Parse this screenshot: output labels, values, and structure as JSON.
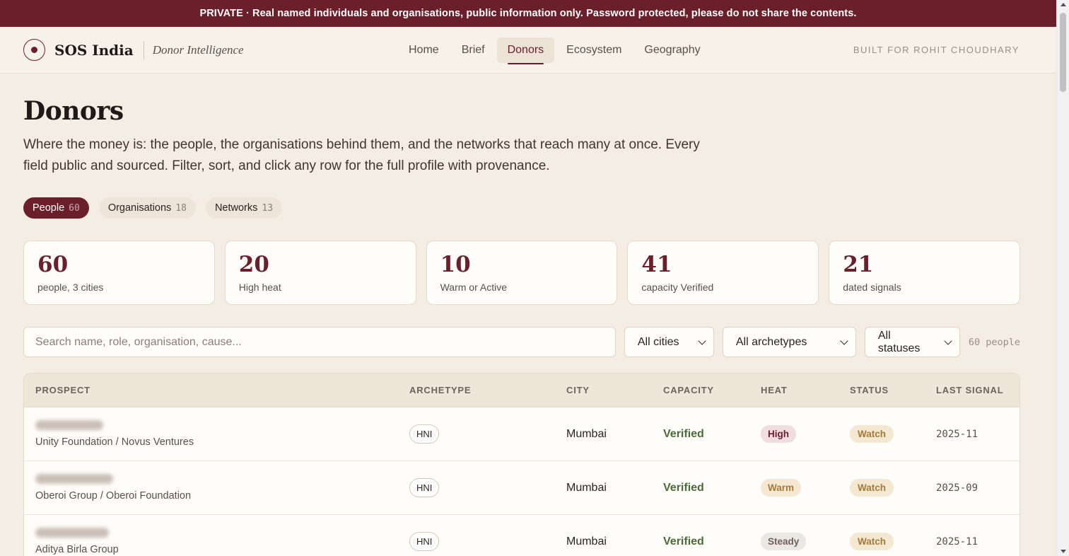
{
  "banner": "PRIVATE · Real named individuals and organisations, public information only. Password protected, please do not share the contents.",
  "brand": {
    "name": "SOS India",
    "subtitle": "Donor Intelligence"
  },
  "nav": [
    "Home",
    "Brief",
    "Donors",
    "Ecosystem",
    "Geography"
  ],
  "nav_active": "Donors",
  "built_for": "BUILT FOR ROHIT CHOUDHARY",
  "page": {
    "title": "Donors",
    "lede": "Where the money is: the people, the organisations behind them, and the networks that reach many at once. Every field public and sourced. Filter, sort, and click any row for the full profile with provenance."
  },
  "segments": [
    {
      "label": "People",
      "count": "60"
    },
    {
      "label": "Organisations",
      "count": "18"
    },
    {
      "label": "Networks",
      "count": "13"
    }
  ],
  "stats": [
    {
      "value": "60",
      "label": "people, 3 cities"
    },
    {
      "value": "20",
      "label": "High heat"
    },
    {
      "value": "10",
      "label": "Warm or Active"
    },
    {
      "value": "41",
      "label": "capacity Verified"
    },
    {
      "value": "21",
      "label": "dated signals"
    }
  ],
  "filters": {
    "search_placeholder": "Search name, role, organisation, cause...",
    "city": "All cities",
    "archetype": "All archetypes",
    "status": "All statuses",
    "result_count": "60 people"
  },
  "table": {
    "headers": [
      "PROSPECT",
      "ARCHETYPE",
      "CITY",
      "CAPACITY",
      "HEAT",
      "STATUS",
      "LAST SIGNAL"
    ],
    "rows": [
      {
        "org": "Unity Foundation / Novus Ventures",
        "archetype": "HNI",
        "city": "Mumbai",
        "capacity": "Verified",
        "heat": "High",
        "status": "Watch",
        "signal": "2025-11"
      },
      {
        "org": "Oberoi Group / Oberoi Foundation",
        "archetype": "HNI",
        "city": "Mumbai",
        "capacity": "Verified",
        "heat": "Warm",
        "status": "Watch",
        "signal": "2025-09"
      },
      {
        "org": "Aditya Birla Group",
        "archetype": "HNI",
        "city": "Mumbai",
        "capacity": "Verified",
        "heat": "Steady",
        "status": "Watch",
        "signal": "2025-11"
      }
    ]
  },
  "colors": {
    "accent": "#6b1f2b",
    "background": "#f4ede3",
    "verified": "#4a6a3a",
    "watch": "#a47a3a"
  }
}
